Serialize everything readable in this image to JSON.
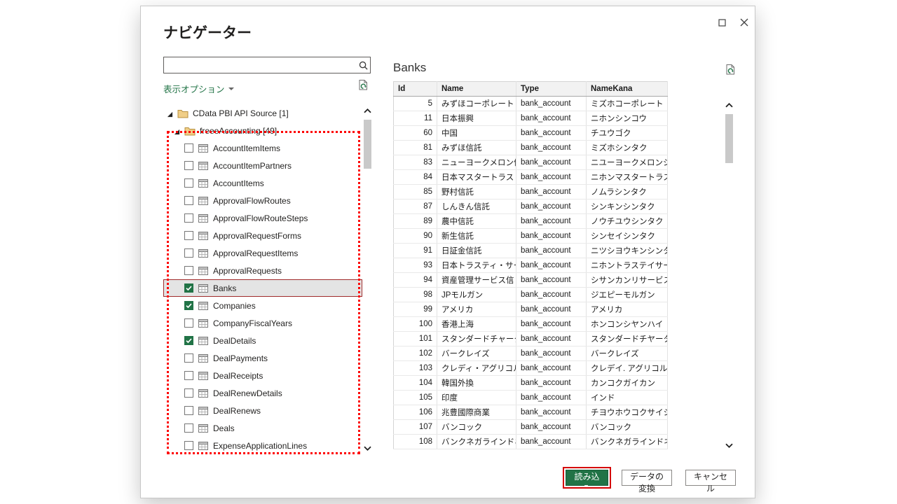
{
  "dialog": {
    "title": "ナビゲーター"
  },
  "left": {
    "search_placeholder": "",
    "display_options_label": "表示オプション",
    "tree": {
      "root_label": "CData PBI API Source [1]",
      "folder_label": "freeeAccounting [49]",
      "items": [
        {
          "label": "AccountItemItems",
          "checked": false,
          "selected": false
        },
        {
          "label": "AccountItemPartners",
          "checked": false,
          "selected": false
        },
        {
          "label": "AccountItems",
          "checked": false,
          "selected": false
        },
        {
          "label": "ApprovalFlowRoutes",
          "checked": false,
          "selected": false
        },
        {
          "label": "ApprovalFlowRouteSteps",
          "checked": false,
          "selected": false
        },
        {
          "label": "ApprovalRequestForms",
          "checked": false,
          "selected": false
        },
        {
          "label": "ApprovalRequestItems",
          "checked": false,
          "selected": false
        },
        {
          "label": "ApprovalRequests",
          "checked": false,
          "selected": false
        },
        {
          "label": "Banks",
          "checked": true,
          "selected": true
        },
        {
          "label": "Companies",
          "checked": true,
          "selected": false
        },
        {
          "label": "CompanyFiscalYears",
          "checked": false,
          "selected": false
        },
        {
          "label": "DealDetails",
          "checked": true,
          "selected": false
        },
        {
          "label": "DealPayments",
          "checked": false,
          "selected": false
        },
        {
          "label": "DealReceipts",
          "checked": false,
          "selected": false
        },
        {
          "label": "DealRenewDetails",
          "checked": false,
          "selected": false
        },
        {
          "label": "DealRenews",
          "checked": false,
          "selected": false
        },
        {
          "label": "Deals",
          "checked": false,
          "selected": false
        },
        {
          "label": "ExpenseApplicationLines",
          "checked": false,
          "selected": false
        }
      ]
    }
  },
  "preview": {
    "title": "Banks",
    "columns": [
      "Id",
      "Name",
      "Type",
      "NameKana"
    ],
    "rows": [
      [
        "5",
        "みずほコーポレート",
        "bank_account",
        "ミズホコーポレート"
      ],
      [
        "11",
        "日本振興",
        "bank_account",
        "ニホンシンコウ"
      ],
      [
        "60",
        "中国",
        "bank_account",
        "チユウゴク"
      ],
      [
        "81",
        "みずほ信託",
        "bank_account",
        "ミズホシンタク"
      ],
      [
        "83",
        "ニューヨークメロン信",
        "bank_account",
        "ニユーヨークメロンシンタ"
      ],
      [
        "84",
        "日本マスタートラスト信",
        "bank_account",
        "ニホンマスタートラストシ"
      ],
      [
        "85",
        "野村信託",
        "bank_account",
        "ノムラシンタク"
      ],
      [
        "87",
        "しんきん信託",
        "bank_account",
        "シンキンシンタク"
      ],
      [
        "89",
        "農中信託",
        "bank_account",
        "ノウチユウシンタク"
      ],
      [
        "90",
        "新生信託",
        "bank_account",
        "シンセイシンタク"
      ],
      [
        "91",
        "日証金信託",
        "bank_account",
        "ニツシヨウキンシンタク"
      ],
      [
        "93",
        "日本トラスティ・サービ",
        "bank_account",
        "ニホントラステイサービ"
      ],
      [
        "94",
        "資産管理サービス信",
        "bank_account",
        "シサンカンリサービスシ"
      ],
      [
        "98",
        "JPモルガン",
        "bank_account",
        "ジエピーモルガン"
      ],
      [
        "99",
        "アメリカ",
        "bank_account",
        "アメリカ"
      ],
      [
        "100",
        "香港上海",
        "bank_account",
        "ホンコンシヤンハイ"
      ],
      [
        "101",
        "スタンダードチャータ",
        "bank_account",
        "スタンダードチヤータード"
      ],
      [
        "102",
        "バークレイズ",
        "bank_account",
        "バークレイズ"
      ],
      [
        "103",
        "クレディ・アグリコル",
        "bank_account",
        "クレデイ. アグリコル"
      ],
      [
        "104",
        "韓国外換",
        "bank_account",
        "カンコクガイカン"
      ],
      [
        "105",
        "印度",
        "bank_account",
        "インド"
      ],
      [
        "106",
        "兆豊國際商業",
        "bank_account",
        "チヨウホウコクサイシ"
      ],
      [
        "107",
        "バンコック",
        "bank_account",
        "バンコック"
      ],
      [
        "108",
        "バンクネガラインドネ",
        "bank_account",
        "バンクネガラインドネシ"
      ]
    ]
  },
  "footer": {
    "load": "読み込み",
    "transform": "データの変換",
    "cancel": "キャンセル"
  },
  "colors": {
    "accent_green": "#217346",
    "annotation_red": "#fe0000",
    "selected_row_border": "#a02b2b"
  }
}
